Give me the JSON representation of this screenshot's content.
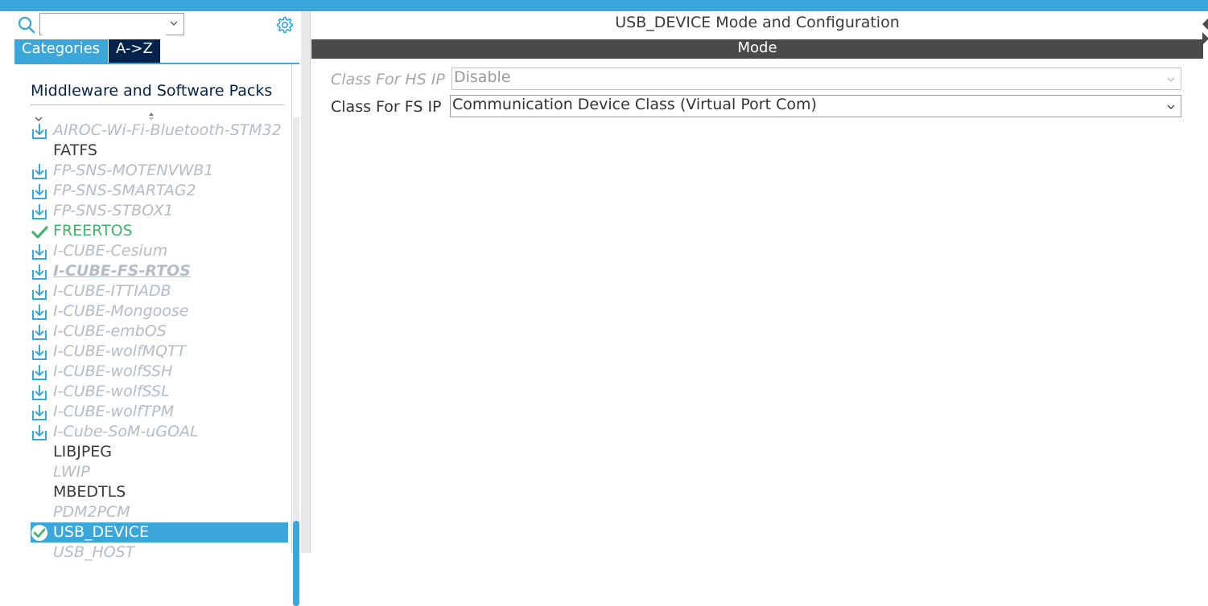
{
  "colors": {
    "accent": "#3aa6d9",
    "dark_navy": "#03234b",
    "mode_bar": "#4a4a4a",
    "active_green": "#45b36b",
    "disabled_text": "#b4bcc4"
  },
  "left_panel": {
    "search": {
      "value": "",
      "placeholder": ""
    },
    "tabs": [
      {
        "label": "Categories",
        "selected": true
      },
      {
        "label": "A->Z",
        "selected": false
      }
    ],
    "group": {
      "label": "Middleware and Software Packs"
    },
    "items": [
      {
        "label": "AIROC-Wi-Fi-Bluetooth-STM32",
        "status": "installable",
        "icon": "download-icon"
      },
      {
        "label": "FATFS",
        "status": "plain",
        "icon": ""
      },
      {
        "label": "FP-SNS-MOTENVWB1",
        "status": "installable",
        "icon": "download-icon"
      },
      {
        "label": "FP-SNS-SMARTAG2",
        "status": "installable",
        "icon": "download-icon"
      },
      {
        "label": "FP-SNS-STBOX1",
        "status": "installable",
        "icon": "download-icon"
      },
      {
        "label": "FREERTOS",
        "status": "active",
        "icon": "check-icon"
      },
      {
        "label": "I-CUBE-Cesium",
        "status": "installable",
        "icon": "download-icon"
      },
      {
        "label": "I-CUBE-FS-RTOS",
        "status": "installable-bold",
        "icon": "download-icon"
      },
      {
        "label": "I-CUBE-ITTIADB",
        "status": "installable",
        "icon": "download-icon"
      },
      {
        "label": "I-CUBE-Mongoose",
        "status": "installable",
        "icon": "download-icon"
      },
      {
        "label": "I-CUBE-embOS",
        "status": "installable",
        "icon": "download-icon"
      },
      {
        "label": "I-CUBE-wolfMQTT",
        "status": "installable",
        "icon": "download-icon"
      },
      {
        "label": "I-CUBE-wolfSSH",
        "status": "installable",
        "icon": "download-icon"
      },
      {
        "label": "I-CUBE-wolfSSL",
        "status": "installable",
        "icon": "download-icon"
      },
      {
        "label": "I-CUBE-wolfTPM",
        "status": "installable",
        "icon": "download-icon"
      },
      {
        "label": "I-Cube-SoM-uGOAL",
        "status": "installable",
        "icon": "download-icon"
      },
      {
        "label": "LIBJPEG",
        "status": "plain",
        "icon": ""
      },
      {
        "label": "LWIP",
        "status": "plain-italic",
        "icon": ""
      },
      {
        "label": "MBEDTLS",
        "status": "plain",
        "icon": ""
      },
      {
        "label": "PDM2PCM",
        "status": "plain-italic",
        "icon": ""
      },
      {
        "label": "USB_DEVICE",
        "status": "selected",
        "icon": "check-circle-icon"
      },
      {
        "label": "USB_HOST",
        "status": "plain-italic",
        "icon": ""
      }
    ]
  },
  "right_panel": {
    "title": "USB_DEVICE Mode and Configuration",
    "mode_label": "Mode",
    "fields": [
      {
        "label": "Class For HS IP",
        "value": "Disable",
        "enabled": false
      },
      {
        "label": "Class For FS IP",
        "value": "Communication Device Class (Virtual Port Com)",
        "enabled": true
      }
    ]
  }
}
